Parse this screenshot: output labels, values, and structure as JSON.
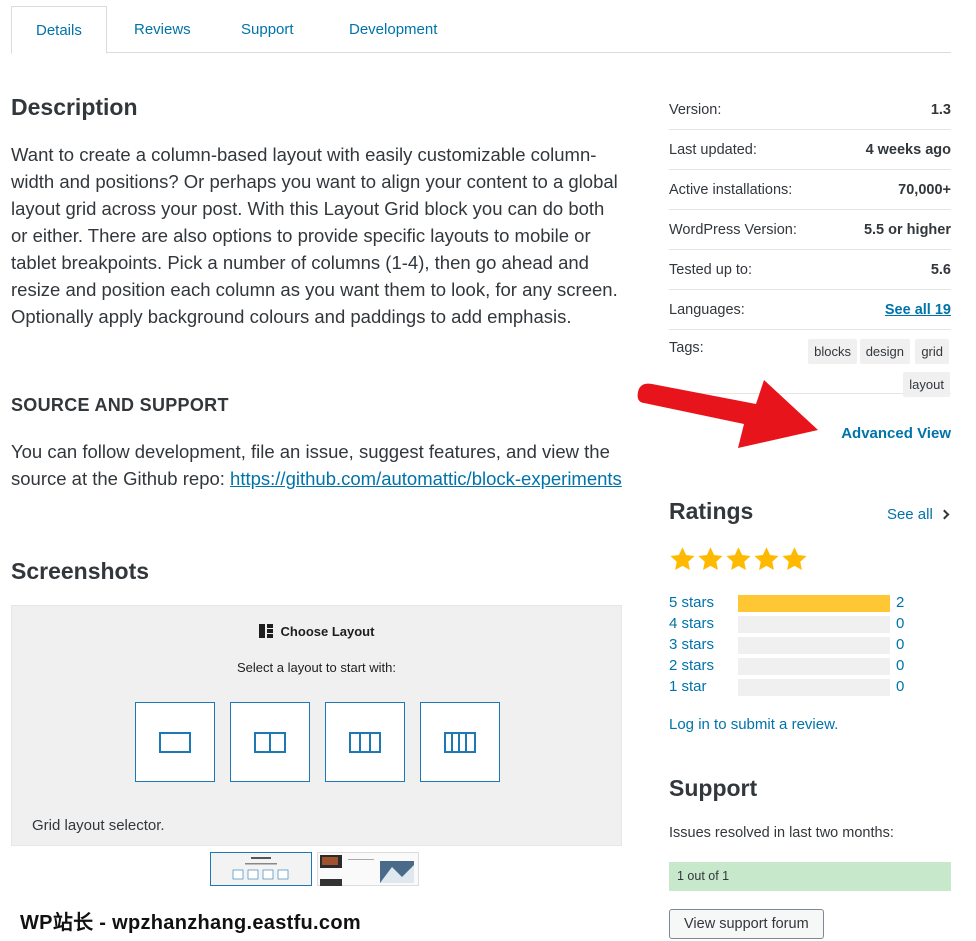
{
  "tabs": [
    {
      "label": "Details",
      "active": true
    },
    {
      "label": "Reviews"
    },
    {
      "label": "Support"
    },
    {
      "label": "Development"
    }
  ],
  "description": {
    "heading": "Description",
    "body": "Want to create a column-based layout with easily customizable column-width and positions? Or perhaps you want to align your content to a global layout grid across your post. With this Layout Grid block you can do both or either. There are also options to provide specific layouts to mobile or tablet breakpoints. Pick a number of columns (1-4), then go ahead and resize and position each column as you want them to look, for any screen. Optionally apply background colours and paddings to add emphasis."
  },
  "source": {
    "heading": "SOURCE AND SUPPORT",
    "body": "You can follow development, file an issue, suggest features, and view the source at the Github repo: ",
    "link": "https://github.com/automattic/block-experiments"
  },
  "screenshots": {
    "heading": "Screenshots",
    "dialog_title": "Choose Layout",
    "dialog_subtitle": "Select a layout to start with:",
    "caption": "Grid layout selector."
  },
  "watermark": "WP站长 - wpzhanzhang.eastfu.com",
  "meta": [
    {
      "key": "Version:",
      "value": "1.3"
    },
    {
      "key": "Last updated:",
      "value": "4 weeks ago"
    },
    {
      "key": "Active installations:",
      "value": "70,000+"
    },
    {
      "key": "WordPress Version:",
      "value": "5.5 or higher"
    },
    {
      "key": "Tested up to:",
      "value": "5.6"
    },
    {
      "key": "Languages:",
      "value": "See all 19"
    }
  ],
  "tags": {
    "label": "Tags:",
    "items": [
      "blocks",
      "design",
      "grid",
      "layout"
    ]
  },
  "advanced_view": "Advanced View",
  "ratings": {
    "heading": "Ratings",
    "see_all": "See all",
    "stars_filled": 5,
    "rows": [
      {
        "label": "5 stars",
        "count": "2",
        "fraction": 1.0
      },
      {
        "label": "4 stars",
        "count": "0",
        "fraction": 0
      },
      {
        "label": "3 stars",
        "count": "0",
        "fraction": 0
      },
      {
        "label": "2 stars",
        "count": "0",
        "fraction": 0
      },
      {
        "label": "1 star",
        "count": "0",
        "fraction": 0
      }
    ],
    "login": "Log in to submit a review."
  },
  "support": {
    "heading": "Support",
    "issues_label": "Issues resolved in last two months:",
    "resolved": "1 out of 1",
    "button": "View support forum"
  },
  "colors": {
    "link": "#0073aa",
    "star": "#ffb900",
    "bar_fill": "#ffc733",
    "resolved_bg": "#c7e8ca",
    "arrow": "#e8141b"
  }
}
